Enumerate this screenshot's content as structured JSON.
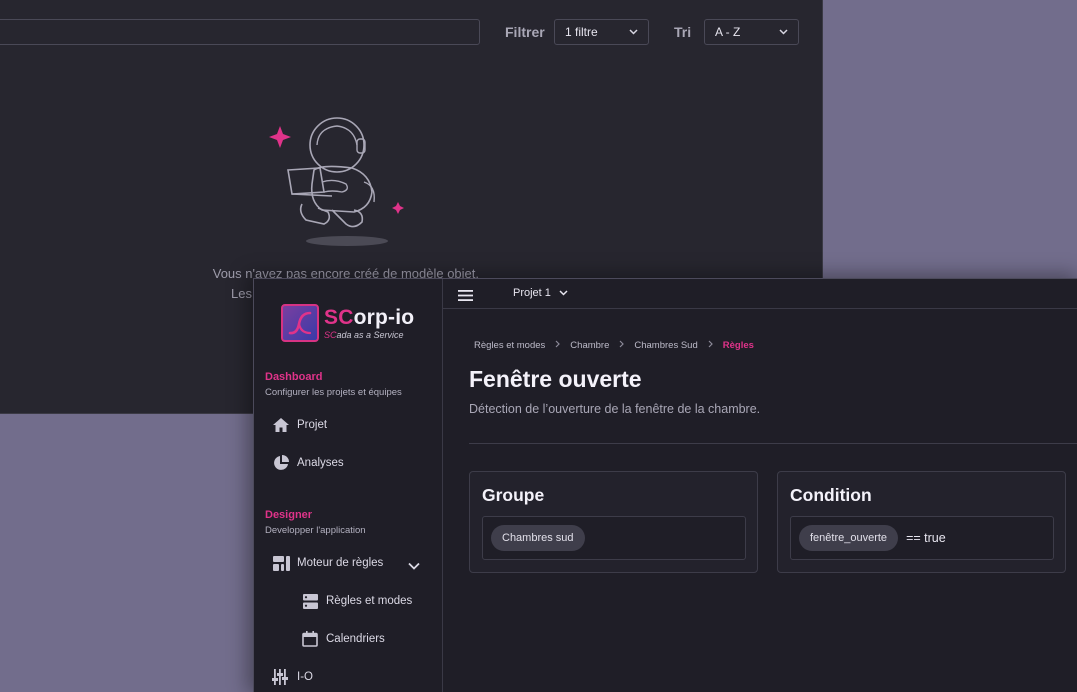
{
  "background_window": {
    "filter_label": "Filtrer",
    "filter_value": "1 filtre",
    "sort_label": "Tri",
    "sort_value": "A - Z",
    "empty_text": "Vous n'avez pas encore créé de modèle objet.",
    "empty_text_2": "Les"
  },
  "brand": {
    "name_accent": "SC",
    "name_rest": "orp-io",
    "tagline_accent": "SC",
    "tagline_rest": "ada as a Service"
  },
  "sidebar": {
    "dashboard_title": "Dashboard",
    "dashboard_sub": "Configurer les projets et équipes",
    "designer_title": "Designer",
    "designer_sub": "Developper l'application",
    "items": [
      {
        "label": "Projet",
        "icon": "home-icon"
      },
      {
        "label": "Analyses",
        "icon": "pie-chart-icon"
      },
      {
        "label": "Moteur de règles",
        "icon": "rules-engine-icon"
      },
      {
        "label": "Règles et modes",
        "icon": "server-icon"
      },
      {
        "label": "Calendriers",
        "icon": "calendar-icon"
      },
      {
        "label": "I-O",
        "icon": "io-sliders-icon"
      }
    ]
  },
  "topbar": {
    "project": "Projet 1"
  },
  "breadcrumb": [
    "Règles et modes",
    "Chambre",
    "Chambres Sud",
    "Règles"
  ],
  "page": {
    "title": "Fenêtre ouverte",
    "description": "Détection de l’ouverture de la fenêtre de la chambre."
  },
  "cards": {
    "groupe": {
      "title": "Groupe",
      "chip": "Chambres sud"
    },
    "condition": {
      "title": "Condition",
      "chip": "fenêtre_ouverte",
      "rest": "== true"
    }
  },
  "colors": {
    "accent": "#e0338a",
    "background": "#1f1e27",
    "desktop": "#726d8c"
  }
}
